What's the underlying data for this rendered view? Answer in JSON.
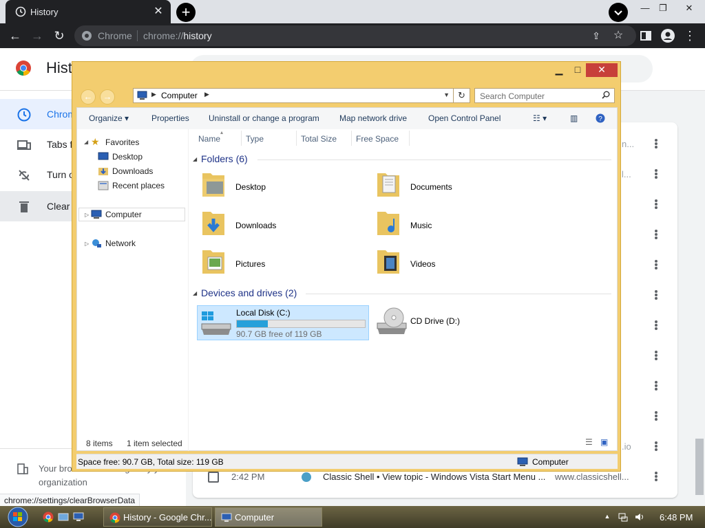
{
  "chrome": {
    "tab_title": "History",
    "omnibox_site": "Chrome",
    "url_prefix": "chrome://",
    "url_path": "history",
    "status_url": "chrome://settings/clearBrowserData"
  },
  "history": {
    "page_title": "History",
    "sidebar": [
      {
        "label": "Chrome history",
        "icon": "clock-icon"
      },
      {
        "label": "Tabs from other devices",
        "icon": "devices-icon"
      },
      {
        "label": "Turn off",
        "icon": "sync-off-icon"
      },
      {
        "label": "Clear browsing data",
        "icon": "trash-icon"
      }
    ],
    "org_notice": "Your browser is managed by your organization",
    "row": {
      "time": "2:42 PM",
      "title": "Classic Shell • View topic - Windows Vista Start Menu ...",
      "domain": "www.classicshell..."
    },
    "truncated": [
      "n...",
      "l...",
      ".io"
    ]
  },
  "explorer": {
    "address_crumb": "Computer",
    "search_placeholder": "Search Computer",
    "commands": [
      "Organize",
      "Properties",
      "Uninstall or change a program",
      "Map network drive",
      "Open Control Panel"
    ],
    "nav": {
      "favorites": "Favorites",
      "favorites_items": [
        "Desktop",
        "Downloads",
        "Recent places"
      ],
      "computer": "Computer",
      "network": "Network"
    },
    "columns": [
      "Name",
      "Type",
      "Total Size",
      "Free Space"
    ],
    "folders_group": "Folders (6)",
    "folders": [
      "Desktop",
      "Documents",
      "Downloads",
      "Music",
      "Pictures",
      "Videos"
    ],
    "devices_group": "Devices and drives (2)",
    "drives": [
      {
        "name": "Local Disk (C:)",
        "free_text": "90.7 GB free of 119 GB",
        "used_fraction": 0.24
      },
      {
        "name": "CD Drive (D:)"
      }
    ],
    "item_count": "8 items",
    "selected_count": "1 item selected",
    "statusbar_space": "Space free: 90.7 GB, Total size: 119 GB",
    "statusbar_location": "Computer"
  },
  "taskbar": {
    "buttons": [
      "History - Google Chr...",
      "Computer"
    ],
    "clock": "6:48 PM"
  }
}
